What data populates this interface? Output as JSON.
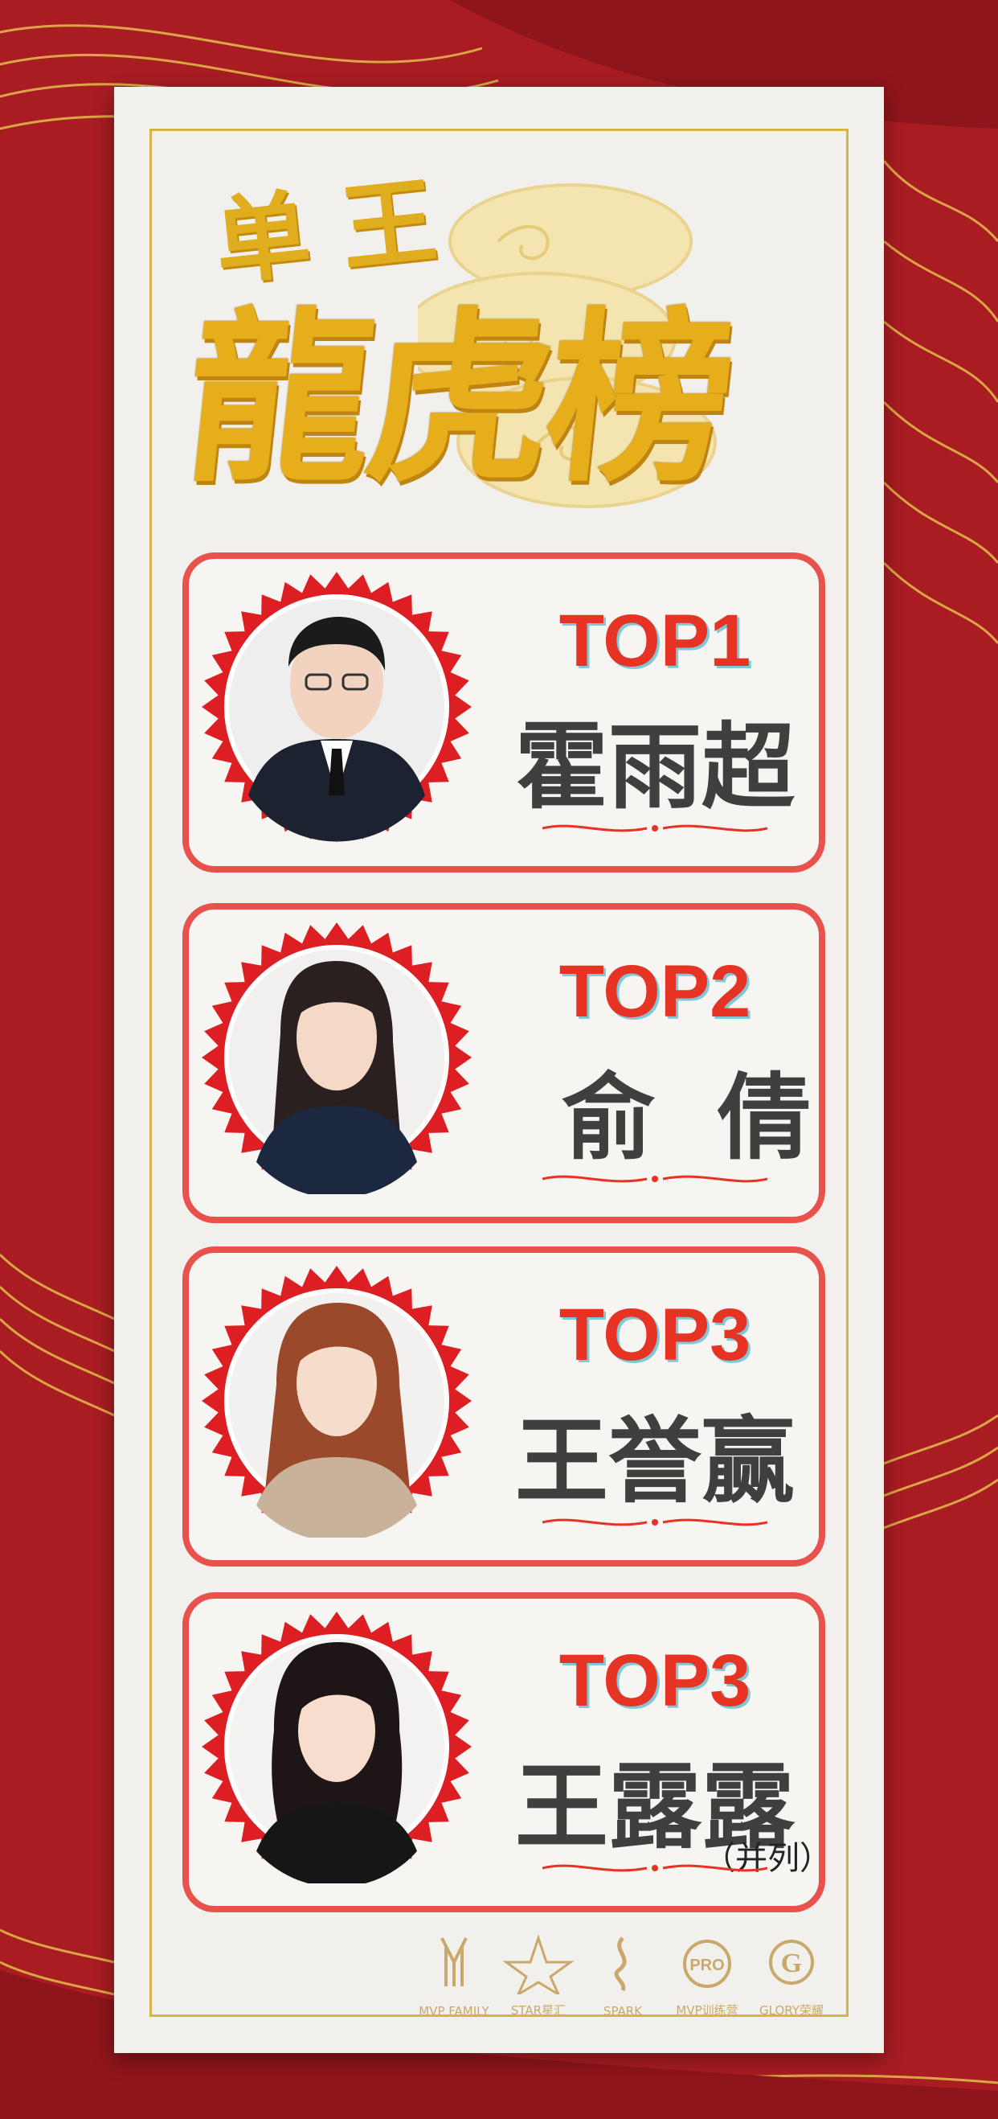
{
  "title": {
    "small": "单王",
    "big": "龍虎榜"
  },
  "cards": [
    {
      "rank": "TOP1",
      "name": "霍雨超",
      "tie": ""
    },
    {
      "rank": "TOP2",
      "name": "俞倩",
      "tie": ""
    },
    {
      "rank": "TOP3",
      "name": "王誉赢",
      "tie": ""
    },
    {
      "rank": "TOP3",
      "name": "王露露",
      "tie": "（并列）"
    }
  ],
  "logos": [
    "MVP FAMILY",
    "STAR星汇",
    "SPARK",
    "MVP训练营",
    "GLORY荣耀"
  ],
  "colors": {
    "background": "#a81c22",
    "gold": "#e6ae1b",
    "card_border": "#e9524c",
    "rank_red": "#e63324"
  }
}
